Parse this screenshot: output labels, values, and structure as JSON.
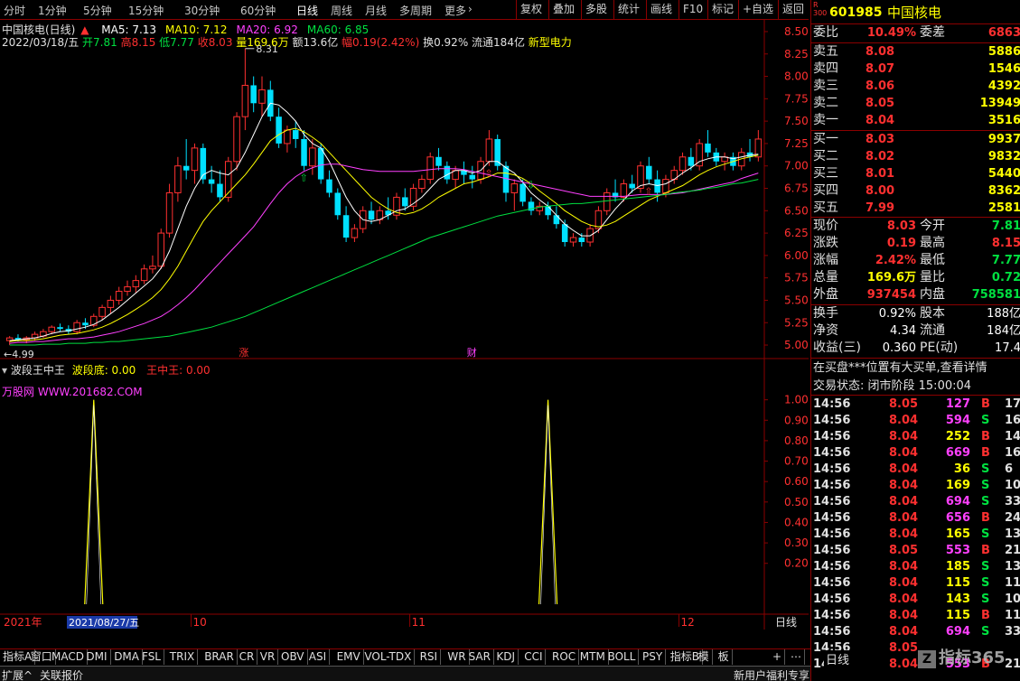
{
  "periods": [
    "分时",
    "1分钟",
    "5分钟",
    "15分钟",
    "30分钟",
    "60分钟",
    "日线",
    "周线",
    "月线",
    "多周期",
    "更多"
  ],
  "period_active": "日线",
  "tools": [
    "复权",
    "叠加",
    "多股",
    "统计",
    "画线",
    "F10",
    "标记",
    "+自选",
    "返回"
  ],
  "chart_title": "中国核电(日线)",
  "ma": [
    {
      "label": "MA5: 7.13",
      "color": "#ffffff"
    },
    {
      "label": "MA10: 7.12",
      "color": "#ffff00"
    },
    {
      "label": "MA20: 6.92",
      "color": "#ff40ff"
    },
    {
      "label": "MA60: 6.85",
      "color": "#00e040"
    }
  ],
  "bar_info": {
    "date": "2022/03/18/五",
    "open": "开7.81",
    "high": "高8.15",
    "low": "低7.77",
    "close": "收8.03",
    "vol": "量169.6万",
    "amount": "额13.6亿",
    "range": "幅0.19(2.42%)",
    "turnover": "换0.92%",
    "float": "流通184亿",
    "sector": "新型电力"
  },
  "price_axis": [
    "8.50",
    "8.25",
    "8.00",
    "7.75",
    "7.50",
    "7.25",
    "7.00",
    "6.75",
    "6.50",
    "6.25",
    "6.00",
    "5.75",
    "5.50",
    "5.25",
    "5.00"
  ],
  "high_label": "8.31",
  "low_label": "4.99",
  "markers": {
    "zhang": "涨",
    "cai": "财"
  },
  "indicator": {
    "name": "波段王中王",
    "line1": "波段底: 0.00",
    "line2": "王中王: 0.00",
    "watermark": "万股网 WWW.201682.COM",
    "axis": [
      "1.00",
      "0.90",
      "0.80",
      "0.70",
      "0.60",
      "0.50",
      "0.40",
      "0.30",
      "0.20"
    ]
  },
  "time_axis": {
    "year": "2021年",
    "cursor_date": "2021/08/27/五",
    "m10": "10",
    "m11": "11",
    "m12": "12",
    "period": "日线"
  },
  "tabs": [
    "指标A",
    "窗口",
    "MACD",
    "DMI",
    "DMA",
    "FSL",
    "TRIX",
    "BRAR",
    "CR",
    "VR",
    "OBV",
    "ASI",
    "EMV",
    "VOL-TDX",
    "RSI",
    "WR",
    "SAR",
    "KDJ",
    "CCI",
    "ROC",
    "MTM",
    "BOLL",
    "PSY",
    "指标B",
    "模",
    "板"
  ],
  "status": {
    "left1": "扩展^",
    "left2": "关联报价",
    "right": "新用户福利专享",
    "brand": "指标365"
  },
  "quote": {
    "code": "601985",
    "name": "中国核电",
    "badge": "R 300",
    "weibi_label": "委比",
    "weibi": "10.49%",
    "weicha_label": "委差",
    "weicha": "6863",
    "sells": [
      {
        "label": "卖五",
        "price": "8.08",
        "vol": "5886"
      },
      {
        "label": "卖四",
        "price": "8.07",
        "vol": "1546"
      },
      {
        "label": "卖三",
        "price": "8.06",
        "vol": "4392"
      },
      {
        "label": "卖二",
        "price": "8.05",
        "vol": "13949"
      },
      {
        "label": "卖一",
        "price": "8.04",
        "vol": "3516"
      }
    ],
    "buys": [
      {
        "label": "买一",
        "price": "8.03",
        "vol": "9937"
      },
      {
        "label": "买二",
        "price": "8.02",
        "vol": "9832"
      },
      {
        "label": "买三",
        "price": "8.01",
        "vol": "5440"
      },
      {
        "label": "买四",
        "price": "8.00",
        "vol": "8362"
      },
      {
        "label": "买五",
        "price": "7.99",
        "vol": "2581"
      }
    ],
    "stats": [
      {
        "l1": "现价",
        "v1": "8.03",
        "c1": "red",
        "l2": "今开",
        "v2": "7.81",
        "c2": "green"
      },
      {
        "l1": "涨跌",
        "v1": "0.19",
        "c1": "red",
        "l2": "最高",
        "v2": "8.15",
        "c2": "red"
      },
      {
        "l1": "涨幅",
        "v1": "2.42%",
        "c1": "red",
        "l2": "最低",
        "v2": "7.77",
        "c2": "green"
      },
      {
        "l1": "总量",
        "v1": "169.6万",
        "c1": "yellow",
        "l2": "量比",
        "v2": "0.72",
        "c2": "green"
      },
      {
        "l1": "外盘",
        "v1": "937454",
        "c1": "red",
        "l2": "内盘",
        "v2": "758581",
        "c2": "green"
      }
    ],
    "stats2": [
      {
        "l1": "换手",
        "v1": "0.92%",
        "l2": "股本",
        "v2": "188亿"
      },
      {
        "l1": "净资",
        "v1": "4.34",
        "l2": "流通",
        "v2": "184亿"
      },
      {
        "l1": "收益(三)",
        "v1": "0.360",
        "l2": "PE(动)",
        "v2": "17.4"
      }
    ],
    "notice": "在买盘***位置有大买单,查看详情",
    "trade_state": "交易状态: 闭市阶段 15:00:04",
    "ticks": [
      {
        "t": "14:56",
        "p": "8.05",
        "v": "127",
        "bs": "B",
        "n": "17",
        "vc": "magenta"
      },
      {
        "t": "14:56",
        "p": "8.04",
        "v": "594",
        "bs": "S",
        "n": "16",
        "vc": "magenta"
      },
      {
        "t": "14:56",
        "p": "8.04",
        "v": "252",
        "bs": "B",
        "n": "14",
        "vc": "yellow"
      },
      {
        "t": "14:56",
        "p": "8.04",
        "v": "669",
        "bs": "B",
        "n": "16",
        "vc": "magenta"
      },
      {
        "t": "14:56",
        "p": "8.04",
        "v": "36",
        "bs": "S",
        "n": "6",
        "vc": "yellow"
      },
      {
        "t": "14:56",
        "p": "8.04",
        "v": "169",
        "bs": "S",
        "n": "10",
        "vc": "yellow"
      },
      {
        "t": "14:56",
        "p": "8.04",
        "v": "694",
        "bs": "S",
        "n": "33",
        "vc": "magenta"
      },
      {
        "t": "14:56",
        "p": "8.04",
        "v": "656",
        "bs": "B",
        "n": "24",
        "vc": "magenta"
      },
      {
        "t": "14:56",
        "p": "8.04",
        "v": "165",
        "bs": "S",
        "n": "13",
        "vc": "yellow"
      },
      {
        "t": "14:56",
        "p": "8.05",
        "v": "553",
        "bs": "B",
        "n": "21",
        "vc": "magenta"
      },
      {
        "t": "14:56",
        "p": "8.04",
        "v": "185",
        "bs": "S",
        "n": "13",
        "vc": "yellow"
      },
      {
        "t": "14:56",
        "p": "8.04",
        "v": "115",
        "bs": "S",
        "n": "11",
        "vc": "yellow"
      },
      {
        "t": "14:56",
        "p": "8.04",
        "v": "143",
        "bs": "S",
        "n": "10",
        "vc": "yellow"
      },
      {
        "t": "14:56",
        "p": "8.04",
        "v": "115",
        "bs": "B",
        "n": "11",
        "vc": "yellow"
      },
      {
        "t": "14:56",
        "p": "8.04",
        "v": "694",
        "bs": "S",
        "n": "33",
        "vc": "magenta"
      },
      {
        "t": "14:56",
        "p": "8.05",
        "v": "",
        "bs": "",
        "n": "",
        "vc": "yellow"
      },
      {
        "t": "14:56",
        "p": "8.04",
        "v": "553",
        "bs": "B",
        "n": "21",
        "vc": "magenta"
      }
    ],
    "side_tab": "日线"
  },
  "chart_data": {
    "type": "candlestick",
    "title": "中国核电(日线)",
    "ylim": [
      4.95,
      8.55
    ],
    "candles": [
      [
        5.05,
        5.1,
        5.0,
        5.08
      ],
      [
        5.08,
        5.12,
        5.04,
        5.06
      ],
      [
        5.06,
        5.1,
        5.02,
        5.08
      ],
      [
        5.08,
        5.15,
        5.05,
        5.12
      ],
      [
        5.1,
        5.18,
        5.08,
        5.15
      ],
      [
        5.15,
        5.22,
        5.12,
        5.2
      ],
      [
        5.2,
        5.24,
        5.15,
        5.18
      ],
      [
        5.18,
        5.22,
        5.12,
        5.15
      ],
      [
        5.15,
        5.28,
        5.12,
        5.25
      ],
      [
        5.25,
        5.3,
        5.18,
        5.22
      ],
      [
        5.22,
        5.35,
        5.2,
        5.32
      ],
      [
        5.32,
        5.45,
        5.28,
        5.42
      ],
      [
        5.42,
        5.55,
        5.35,
        5.5
      ],
      [
        5.5,
        5.65,
        5.45,
        5.6
      ],
      [
        5.6,
        5.72,
        5.55,
        5.65
      ],
      [
        5.65,
        5.78,
        5.58,
        5.72
      ],
      [
        5.72,
        5.9,
        5.68,
        5.85
      ],
      [
        5.85,
        6.0,
        5.8,
        5.88
      ],
      [
        5.88,
        6.3,
        5.85,
        6.25
      ],
      [
        6.25,
        6.8,
        6.2,
        6.7
      ],
      [
        6.7,
        7.1,
        6.6,
        7.0
      ],
      [
        7.0,
        7.3,
        6.85,
        6.95
      ],
      [
        6.95,
        7.25,
        6.8,
        7.2
      ],
      [
        7.2,
        7.25,
        6.8,
        6.85
      ],
      [
        6.85,
        7.0,
        6.7,
        6.8
      ],
      [
        6.8,
        6.95,
        6.6,
        6.65
      ],
      [
        6.65,
        7.1,
        6.6,
        7.05
      ],
      [
        7.05,
        7.6,
        6.95,
        7.55
      ],
      [
        7.55,
        8.31,
        7.4,
        7.9
      ],
      [
        7.9,
        8.0,
        7.6,
        7.7
      ],
      [
        7.7,
        8.0,
        7.55,
        7.85
      ],
      [
        7.85,
        7.95,
        7.5,
        7.55
      ],
      [
        7.55,
        7.65,
        7.2,
        7.25
      ],
      [
        7.25,
        7.45,
        7.15,
        7.4
      ],
      [
        7.4,
        7.5,
        7.2,
        7.3
      ],
      [
        7.3,
        7.4,
        6.95,
        7.0
      ],
      [
        7.0,
        7.3,
        6.9,
        7.2
      ],
      [
        7.2,
        7.25,
        6.8,
        6.85
      ],
      [
        6.85,
        6.95,
        6.65,
        6.7
      ],
      [
        6.7,
        6.75,
        6.4,
        6.45
      ],
      [
        6.45,
        6.55,
        6.15,
        6.2
      ],
      [
        6.2,
        6.35,
        6.15,
        6.3
      ],
      [
        6.3,
        6.55,
        6.25,
        6.5
      ],
      [
        6.5,
        6.6,
        6.35,
        6.4
      ],
      [
        6.4,
        6.55,
        6.35,
        6.5
      ],
      [
        6.5,
        6.65,
        6.4,
        6.45
      ],
      [
        6.45,
        6.7,
        6.4,
        6.65
      ],
      [
        6.65,
        6.75,
        6.5,
        6.55
      ],
      [
        6.55,
        6.8,
        6.5,
        6.75
      ],
      [
        6.75,
        6.9,
        6.7,
        6.85
      ],
      [
        6.85,
        7.15,
        6.8,
        7.1
      ],
      [
        7.1,
        7.2,
        6.95,
        7.0
      ],
      [
        7.0,
        7.05,
        6.8,
        6.85
      ],
      [
        6.85,
        7.0,
        6.75,
        6.95
      ],
      [
        6.95,
        7.05,
        6.8,
        6.9
      ],
      [
        6.9,
        7.0,
        6.75,
        6.85
      ],
      [
        6.85,
        7.1,
        6.8,
        7.05
      ],
      [
        7.05,
        7.4,
        7.0,
        7.3
      ],
      [
        7.3,
        7.35,
        6.95,
        7.0
      ],
      [
        7.0,
        7.05,
        6.6,
        6.7
      ],
      [
        6.7,
        6.85,
        6.5,
        6.8
      ],
      [
        6.8,
        6.85,
        6.55,
        6.6
      ],
      [
        6.6,
        6.65,
        6.45,
        6.5
      ],
      [
        6.5,
        6.6,
        6.45,
        6.55
      ],
      [
        6.55,
        6.6,
        6.4,
        6.45
      ],
      [
        6.45,
        6.55,
        6.3,
        6.35
      ],
      [
        6.35,
        6.4,
        6.1,
        6.15
      ],
      [
        6.15,
        6.25,
        6.1,
        6.2
      ],
      [
        6.2,
        6.25,
        6.1,
        6.15
      ],
      [
        6.15,
        6.35,
        6.1,
        6.3
      ],
      [
        6.3,
        6.55,
        6.25,
        6.5
      ],
      [
        6.5,
        6.75,
        6.45,
        6.7
      ],
      [
        6.7,
        6.85,
        6.6,
        6.65
      ],
      [
        6.65,
        6.85,
        6.6,
        6.8
      ],
      [
        6.8,
        6.9,
        6.7,
        6.75
      ],
      [
        6.75,
        7.05,
        6.7,
        7.0
      ],
      [
        7.0,
        7.1,
        6.8,
        6.85
      ],
      [
        6.85,
        6.95,
        6.6,
        6.7
      ],
      [
        6.7,
        6.9,
        6.65,
        6.85
      ],
      [
        6.85,
        7.0,
        6.8,
        6.95
      ],
      [
        6.95,
        7.15,
        6.9,
        7.1
      ],
      [
        7.1,
        7.2,
        6.95,
        7.0
      ],
      [
        7.0,
        7.3,
        6.95,
        7.25
      ],
      [
        7.25,
        7.4,
        7.1,
        7.15
      ],
      [
        7.15,
        7.2,
        7.0,
        7.05
      ],
      [
        7.05,
        7.15,
        6.95,
        7.1
      ],
      [
        7.1,
        7.15,
        6.95,
        7.0
      ],
      [
        7.0,
        7.2,
        6.95,
        7.15
      ],
      [
        7.15,
        7.3,
        7.05,
        7.1
      ],
      [
        7.1,
        7.4,
        7.05,
        7.3
      ]
    ],
    "ma_series": [
      {
        "name": "MA5",
        "color": "#ffffff",
        "values": [
          5.05,
          5.06,
          5.07,
          5.08,
          5.1,
          5.13,
          5.15,
          5.16,
          5.18,
          5.2,
          5.23,
          5.28,
          5.35,
          5.42,
          5.5,
          5.58,
          5.66,
          5.74,
          5.86,
          6.05,
          6.3,
          6.55,
          6.75,
          6.9,
          6.95,
          6.92,
          6.9,
          6.98,
          7.15,
          7.35,
          7.55,
          7.7,
          7.68,
          7.6,
          7.5,
          7.35,
          7.25,
          7.2,
          7.05,
          6.85,
          6.65,
          6.5,
          6.4,
          6.38,
          6.4,
          6.45,
          6.5,
          6.52,
          6.58,
          6.65,
          6.75,
          6.85,
          6.9,
          6.95,
          6.95,
          6.92,
          6.95,
          7.05,
          7.05,
          6.98,
          6.92,
          6.82,
          6.7,
          6.62,
          6.55,
          6.45,
          6.35,
          6.28,
          6.22,
          6.22,
          6.28,
          6.4,
          6.52,
          6.62,
          6.72,
          6.78,
          6.8,
          6.78,
          6.8,
          6.85,
          6.92,
          6.98,
          7.05,
          7.08,
          7.1,
          7.1,
          7.08,
          7.1,
          7.12,
          7.13
        ]
      },
      {
        "name": "MA10",
        "color": "#ffff00",
        "values": [
          5.04,
          5.05,
          5.05,
          5.06,
          5.07,
          5.09,
          5.11,
          5.12,
          5.13,
          5.15,
          5.17,
          5.2,
          5.24,
          5.29,
          5.34,
          5.4,
          5.46,
          5.53,
          5.62,
          5.74,
          5.88,
          6.05,
          6.22,
          6.38,
          6.5,
          6.6,
          6.7,
          6.8,
          6.9,
          7.02,
          7.15,
          7.28,
          7.35,
          7.4,
          7.42,
          7.38,
          7.32,
          7.25,
          7.15,
          7.05,
          6.95,
          6.85,
          6.75,
          6.65,
          6.58,
          6.52,
          6.48,
          6.46,
          6.48,
          6.52,
          6.58,
          6.65,
          6.7,
          6.75,
          6.8,
          6.82,
          6.85,
          6.88,
          6.92,
          6.92,
          6.9,
          6.86,
          6.8,
          6.72,
          6.65,
          6.58,
          6.5,
          6.44,
          6.38,
          6.34,
          6.32,
          6.34,
          6.38,
          6.44,
          6.5,
          6.56,
          6.62,
          6.66,
          6.7,
          6.74,
          6.78,
          6.84,
          6.9,
          6.95,
          6.99,
          7.02,
          7.05,
          7.08,
          7.1,
          7.12
        ]
      },
      {
        "name": "MA20",
        "color": "#ff40ff",
        "values": [
          5.02,
          5.03,
          5.03,
          5.04,
          5.04,
          5.05,
          5.06,
          5.07,
          5.07,
          5.08,
          5.09,
          5.11,
          5.13,
          5.15,
          5.18,
          5.21,
          5.24,
          5.28,
          5.32,
          5.38,
          5.45,
          5.53,
          5.62,
          5.72,
          5.82,
          5.92,
          6.02,
          6.12,
          6.22,
          6.32,
          6.45,
          6.58,
          6.7,
          6.8,
          6.88,
          6.94,
          6.98,
          7.01,
          7.02,
          7.02,
          7.0,
          6.98,
          6.96,
          6.95,
          6.94,
          6.94,
          6.94,
          6.94,
          6.94,
          6.95,
          6.96,
          6.97,
          6.97,
          6.97,
          6.96,
          6.94,
          6.92,
          6.9,
          6.88,
          6.86,
          6.84,
          6.82,
          6.8,
          6.78,
          6.76,
          6.74,
          6.72,
          6.7,
          6.68,
          6.66,
          6.66,
          6.66,
          6.66,
          6.66,
          6.67,
          6.68,
          6.68,
          6.68,
          6.68,
          6.69,
          6.7,
          6.72,
          6.74,
          6.76,
          6.78,
          6.8,
          6.82,
          6.86,
          6.89,
          6.92
        ]
      },
      {
        "name": "MA60",
        "color": "#00e040",
        "values": [
          5.0,
          5.0,
          5.0,
          5.0,
          5.01,
          5.01,
          5.01,
          5.02,
          5.02,
          5.02,
          5.03,
          5.03,
          5.04,
          5.04,
          5.05,
          5.06,
          5.07,
          5.08,
          5.09,
          5.1,
          5.12,
          5.14,
          5.16,
          5.18,
          5.2,
          5.23,
          5.26,
          5.29,
          5.32,
          5.36,
          5.4,
          5.44,
          5.48,
          5.52,
          5.56,
          5.6,
          5.64,
          5.68,
          5.72,
          5.76,
          5.8,
          5.84,
          5.88,
          5.92,
          5.96,
          6.0,
          6.04,
          6.08,
          6.12,
          6.16,
          6.2,
          6.23,
          6.26,
          6.29,
          6.32,
          6.35,
          6.38,
          6.41,
          6.44,
          6.46,
          6.48,
          6.5,
          6.52,
          6.54,
          6.55,
          6.56,
          6.57,
          6.58,
          6.58,
          6.59,
          6.6,
          6.61,
          6.62,
          6.63,
          6.64,
          6.65,
          6.66,
          6.67,
          6.68,
          6.7,
          6.71,
          6.72,
          6.73,
          6.75,
          6.76,
          6.78,
          6.8,
          6.81,
          6.83,
          6.85
        ]
      }
    ],
    "indicator_peaks": [
      {
        "index": 10,
        "value": 1.0
      },
      {
        "index": 64,
        "value": 1.0
      }
    ],
    "indicator_ylim": [
      0,
      1.1
    ]
  }
}
